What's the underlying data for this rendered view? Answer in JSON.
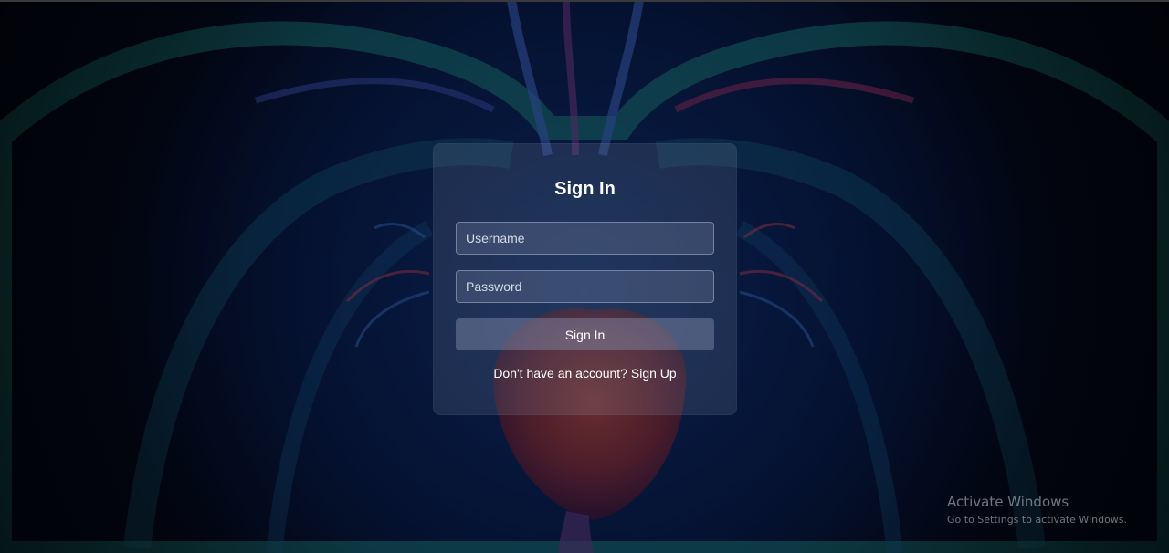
{
  "login": {
    "title": "Sign In",
    "username_placeholder": "Username",
    "password_placeholder": "Password",
    "submit_label": "Sign In",
    "signup_prompt": "Don't have an account?",
    "signup_link": "Sign Up"
  },
  "watermark": {
    "title": "Activate Windows",
    "subtitle": "Go to Settings to activate Windows."
  },
  "background": {
    "image": "anatomical-heart-illustration"
  }
}
